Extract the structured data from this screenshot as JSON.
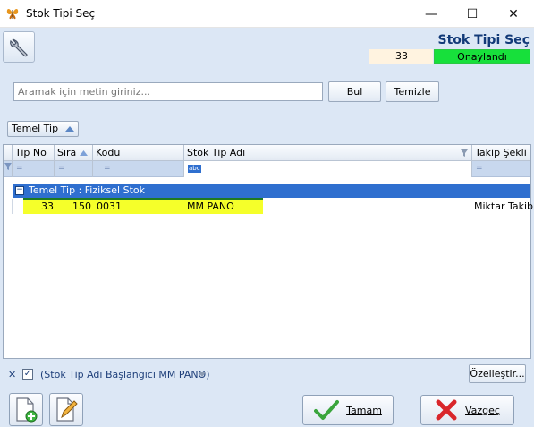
{
  "window": {
    "title": "Stok Tipi Seç",
    "minimize": "—",
    "maximize": "☐",
    "close": "✕"
  },
  "header": {
    "form_title": "Stok Tipi Seç",
    "count": "33",
    "status": "Onaylandı",
    "status_color": "#17e03b"
  },
  "search": {
    "placeholder": "Aramak için metin giriniz...",
    "value": "",
    "find_label": "Bul",
    "clear_label": "Temizle"
  },
  "grouping": {
    "group_button": "Temel Tip"
  },
  "grid": {
    "columns": [
      "Tip No",
      "Sıra",
      "Kodu",
      "Stok Tip Adı",
      "Takip Şekli"
    ],
    "filter_placeholder": "=",
    "filter_text_icon": "abc",
    "group_label": "Temel Tip : Fiziksel Stok",
    "rows": [
      {
        "tip_no": "33",
        "sira": "150",
        "kodu": "0031",
        "stok_tip_adi": "MM PANO",
        "takip_sekli": "Miktar Takibi"
      }
    ],
    "highlight_color": "#f5ff2a"
  },
  "filter_bar": {
    "close": "✕",
    "text": "(Stok Tip Adı Başlangıcı MM PANO)",
    "customize_label": "Özelleştir..."
  },
  "footer": {
    "ok_label": "Tamam",
    "cancel_label": "Vazgeç"
  }
}
